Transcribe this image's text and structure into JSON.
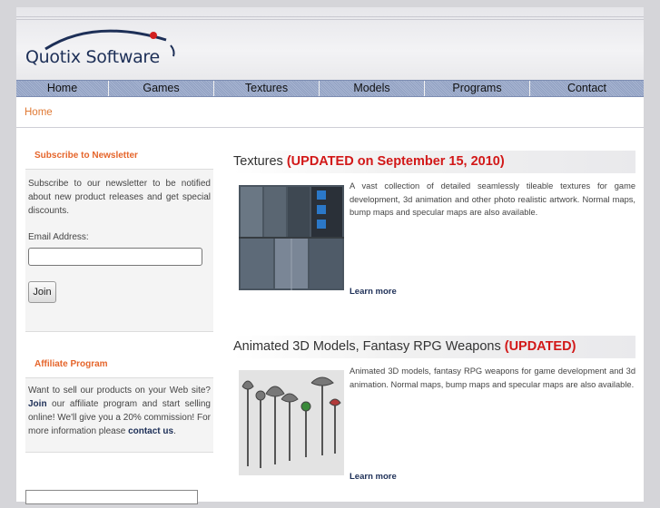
{
  "brand": {
    "logo_text": "Quotix Software"
  },
  "nav": {
    "items": [
      {
        "label": "Home"
      },
      {
        "label": "Games"
      },
      {
        "label": "Textures"
      },
      {
        "label": "Models"
      },
      {
        "label": "Programs"
      },
      {
        "label": "Contact"
      }
    ]
  },
  "breadcrumb": {
    "home": "Home"
  },
  "sidebar": {
    "newsletter": {
      "title": "Subscribe to Newsletter",
      "text": "Subscribe to our newsletter to be notified about new product releases and get special discounts.",
      "email_label": "Email Address:",
      "email_value": "",
      "join_label": "Join"
    },
    "affiliate": {
      "title": "Affiliate Program",
      "text_1": "Want to sell our products on your Web site? ",
      "join_link": "Join",
      "text_2": " our affiliate program and start selling online! We'll give you a 20% commission! For more information please ",
      "contact_link": "contact us",
      "text_3": "."
    }
  },
  "products": [
    {
      "title": "Textures ",
      "updated": "(UPDATED on September 15, 2010)",
      "description": "A vast collection of detailed seamlessly tileable textures for game development, 3d animation and other photo realistic artwork. Normal maps, bump maps and specular maps are also available.",
      "learn_more": "Learn more"
    },
    {
      "title": "Animated 3D Models, Fantasy RPG Weapons ",
      "updated": "(UPDATED)",
      "description": "Animated 3D models, fantasy RPG weapons for game development and 3d animation. Normal maps, bump maps and specular maps are also available.",
      "learn_more": "Learn more"
    }
  ],
  "colors": {
    "accent_orange": "#e5652b",
    "updated_red": "#d21818",
    "brand_navy": "#1d2f57",
    "nav_blue": "#a9b6d3"
  }
}
